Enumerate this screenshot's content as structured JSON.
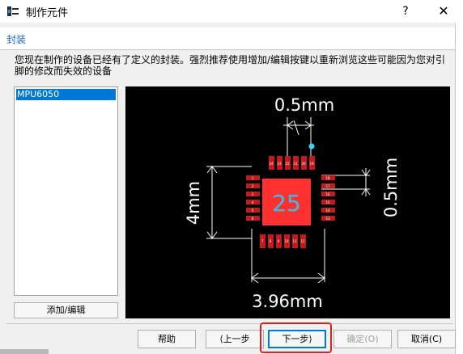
{
  "window": {
    "title": "制作元件",
    "help_glyph": "?",
    "close_glyph": "✕"
  },
  "section": {
    "title": "封装"
  },
  "description": "您现在制作的设备已经有了定义的封装。强烈推荐使用增加/编辑按键以重新浏览这些可能因为您对引脚的修改而失效的设备",
  "package_list": {
    "items": [
      "MPU6050"
    ],
    "selected_index": 0
  },
  "add_edit_label": "添加/编辑",
  "preview": {
    "pin_pitch_top": "0.5mm",
    "pin_pitch_right": "0.5mm",
    "body_height": "4mm",
    "body_width": "3.96mm",
    "center_pad": "25",
    "pin_labels_top": [
      "24",
      "23",
      "22",
      "21",
      "20",
      "19"
    ],
    "pin_labels_left": [
      "1",
      "2",
      "3",
      "4",
      "5",
      "6"
    ],
    "pin_labels_right": [
      "18",
      "17",
      "16",
      "15",
      "14",
      "13"
    ],
    "pin_labels_bottom": [
      "7",
      "8",
      "9",
      "10",
      "11",
      "12"
    ],
    "colors": {
      "background": "#000000",
      "pad": "#c41a1a",
      "center_pad": "#ff3030",
      "dimension": "#ffffff",
      "center_label": "#35c0e8",
      "pin1_marker": "#35d7ff"
    }
  },
  "buttons": {
    "help": "帮助",
    "back": "⟨上一步",
    "next": "下一步⟩",
    "ok": "确定(O)",
    "cancel": "取消(C)"
  },
  "colors": {
    "section_title": "#1c64b4",
    "selection": "#0078d7",
    "highlight_box": "#e0201b"
  }
}
